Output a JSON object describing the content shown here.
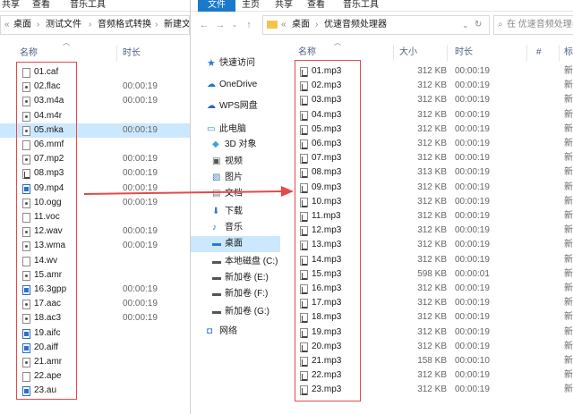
{
  "left": {
    "ribbon": [
      "共享",
      "查看",
      "音乐工具"
    ],
    "breadcrumb": [
      "桌面",
      "测试文件",
      "音频格式转换",
      "新建文"
    ],
    "col_name": "名称",
    "col_time": "时长",
    "files": [
      {
        "name": "01.caf",
        "time": "",
        "icon": "plain"
      },
      {
        "name": "02.flac",
        "time": "00:00:19",
        "icon": "dark"
      },
      {
        "name": "03.m4a",
        "time": "00:00:19",
        "icon": "dark"
      },
      {
        "name": "04.m4r",
        "time": "",
        "icon": "dark"
      },
      {
        "name": "05.mka",
        "time": "00:00:19",
        "icon": "dark",
        "selected": true
      },
      {
        "name": "06.mmf",
        "time": "",
        "icon": "plain"
      },
      {
        "name": "07.mp2",
        "time": "00:00:19",
        "icon": "dark"
      },
      {
        "name": "08.mp3",
        "time": "00:00:19",
        "icon": "mp3"
      },
      {
        "name": "09.mp4",
        "time": "00:00:19",
        "icon": "blue"
      },
      {
        "name": "10.ogg",
        "time": "00:00:19",
        "icon": "dark"
      },
      {
        "name": "11.voc",
        "time": "",
        "icon": "plain"
      },
      {
        "name": "12.wav",
        "time": "00:00:19",
        "icon": "dark"
      },
      {
        "name": "13.wma",
        "time": "00:00:19",
        "icon": "dark"
      },
      {
        "name": "14.wv",
        "time": "",
        "icon": "plain"
      },
      {
        "name": "15.amr",
        "time": "",
        "icon": "dark"
      },
      {
        "name": "16.3gpp",
        "time": "00:00:19",
        "icon": "blue"
      },
      {
        "name": "17.aac",
        "time": "00:00:19",
        "icon": "dark"
      },
      {
        "name": "18.ac3",
        "time": "00:00:19",
        "icon": "dark"
      },
      {
        "name": "19.aifc",
        "time": "",
        "icon": "blue"
      },
      {
        "name": "20.aiff",
        "time": "",
        "icon": "blue"
      },
      {
        "name": "21.amr",
        "time": "",
        "icon": "dark"
      },
      {
        "name": "22.ape",
        "time": "",
        "icon": "plain"
      },
      {
        "name": "23.au",
        "time": "",
        "icon": "blue"
      }
    ]
  },
  "right": {
    "ribbon": [
      "文件",
      "主页",
      "共享",
      "查看",
      "音乐工具"
    ],
    "breadcrumb": [
      "桌面",
      "优速音频处理器"
    ],
    "search_placeholder": "在 优速音频处理器 中",
    "col_name": "名称",
    "col_size": "大小",
    "col_time": "时长",
    "col_num": "#",
    "col_extra": "标",
    "nav": [
      {
        "label": "快速访问",
        "icon": "star"
      },
      {
        "label": "OneDrive",
        "icon": "cloud"
      },
      {
        "label": "WPS网盘",
        "icon": "wps"
      },
      {
        "label": "此电脑",
        "icon": "pc"
      },
      {
        "label": "3D 对象",
        "icon": "cube"
      },
      {
        "label": "视频",
        "icon": "video"
      },
      {
        "label": "图片",
        "icon": "picture"
      },
      {
        "label": "文档",
        "icon": "doc"
      },
      {
        "label": "下载",
        "icon": "download"
      },
      {
        "label": "音乐",
        "icon": "music"
      },
      {
        "label": "桌面",
        "icon": "desktop",
        "selected": true
      },
      {
        "label": "本地磁盘 (C:)",
        "icon": "drive-c"
      },
      {
        "label": "新加卷 (E:)",
        "icon": "drive"
      },
      {
        "label": "新加卷 (F:)",
        "icon": "drive"
      },
      {
        "label": "新加卷 (G:)",
        "icon": "drive"
      },
      {
        "label": "网络",
        "icon": "network"
      }
    ],
    "files": [
      {
        "name": "01.mp3",
        "size": "312 KB",
        "time": "00:00:19",
        "extra": "新"
      },
      {
        "name": "02.mp3",
        "size": "312 KB",
        "time": "00:00:19",
        "extra": "新"
      },
      {
        "name": "03.mp3",
        "size": "312 KB",
        "time": "00:00:19",
        "extra": "新"
      },
      {
        "name": "04.mp3",
        "size": "312 KB",
        "time": "00:00:19",
        "extra": "新"
      },
      {
        "name": "05.mp3",
        "size": "312 KB",
        "time": "00:00:19",
        "extra": "新"
      },
      {
        "name": "06.mp3",
        "size": "312 KB",
        "time": "00:00:19",
        "extra": "新"
      },
      {
        "name": "07.mp3",
        "size": "312 KB",
        "time": "00:00:19",
        "extra": "新"
      },
      {
        "name": "08.mp3",
        "size": "313 KB",
        "time": "00:00:19",
        "extra": "新"
      },
      {
        "name": "09.mp3",
        "size": "312 KB",
        "time": "00:00:19",
        "extra": "新"
      },
      {
        "name": "10.mp3",
        "size": "312 KB",
        "time": "00:00:19",
        "extra": "新"
      },
      {
        "name": "11.mp3",
        "size": "312 KB",
        "time": "00:00:19",
        "extra": "新"
      },
      {
        "name": "12.mp3",
        "size": "312 KB",
        "time": "00:00:19",
        "extra": "新"
      },
      {
        "name": "13.mp3",
        "size": "312 KB",
        "time": "00:00:19",
        "extra": "新"
      },
      {
        "name": "14.mp3",
        "size": "312 KB",
        "time": "00:00:19",
        "extra": "新"
      },
      {
        "name": "15.mp3",
        "size": "598 KB",
        "time": "00:00:01",
        "extra": "新"
      },
      {
        "name": "16.mp3",
        "size": "312 KB",
        "time": "00:00:19",
        "extra": "新"
      },
      {
        "name": "17.mp3",
        "size": "312 KB",
        "time": "00:00:19",
        "extra": "新"
      },
      {
        "name": "18.mp3",
        "size": "312 KB",
        "time": "00:00:19",
        "extra": "新"
      },
      {
        "name": "19.mp3",
        "size": "312 KB",
        "time": "00:00:19",
        "extra": "新"
      },
      {
        "name": "20.mp3",
        "size": "312 KB",
        "time": "00:00:19",
        "extra": "新"
      },
      {
        "name": "21.mp3",
        "size": "158 KB",
        "time": "00:00:10",
        "extra": "新"
      },
      {
        "name": "22.mp3",
        "size": "312 KB",
        "time": "00:00:19",
        "extra": "新"
      },
      {
        "name": "23.mp3",
        "size": "312 KB",
        "time": "00:00:19",
        "extra": "新"
      }
    ]
  },
  "colors": {
    "accent": "#1979ca",
    "selection": "#cce8ff",
    "annotation": "#e34a4a"
  }
}
